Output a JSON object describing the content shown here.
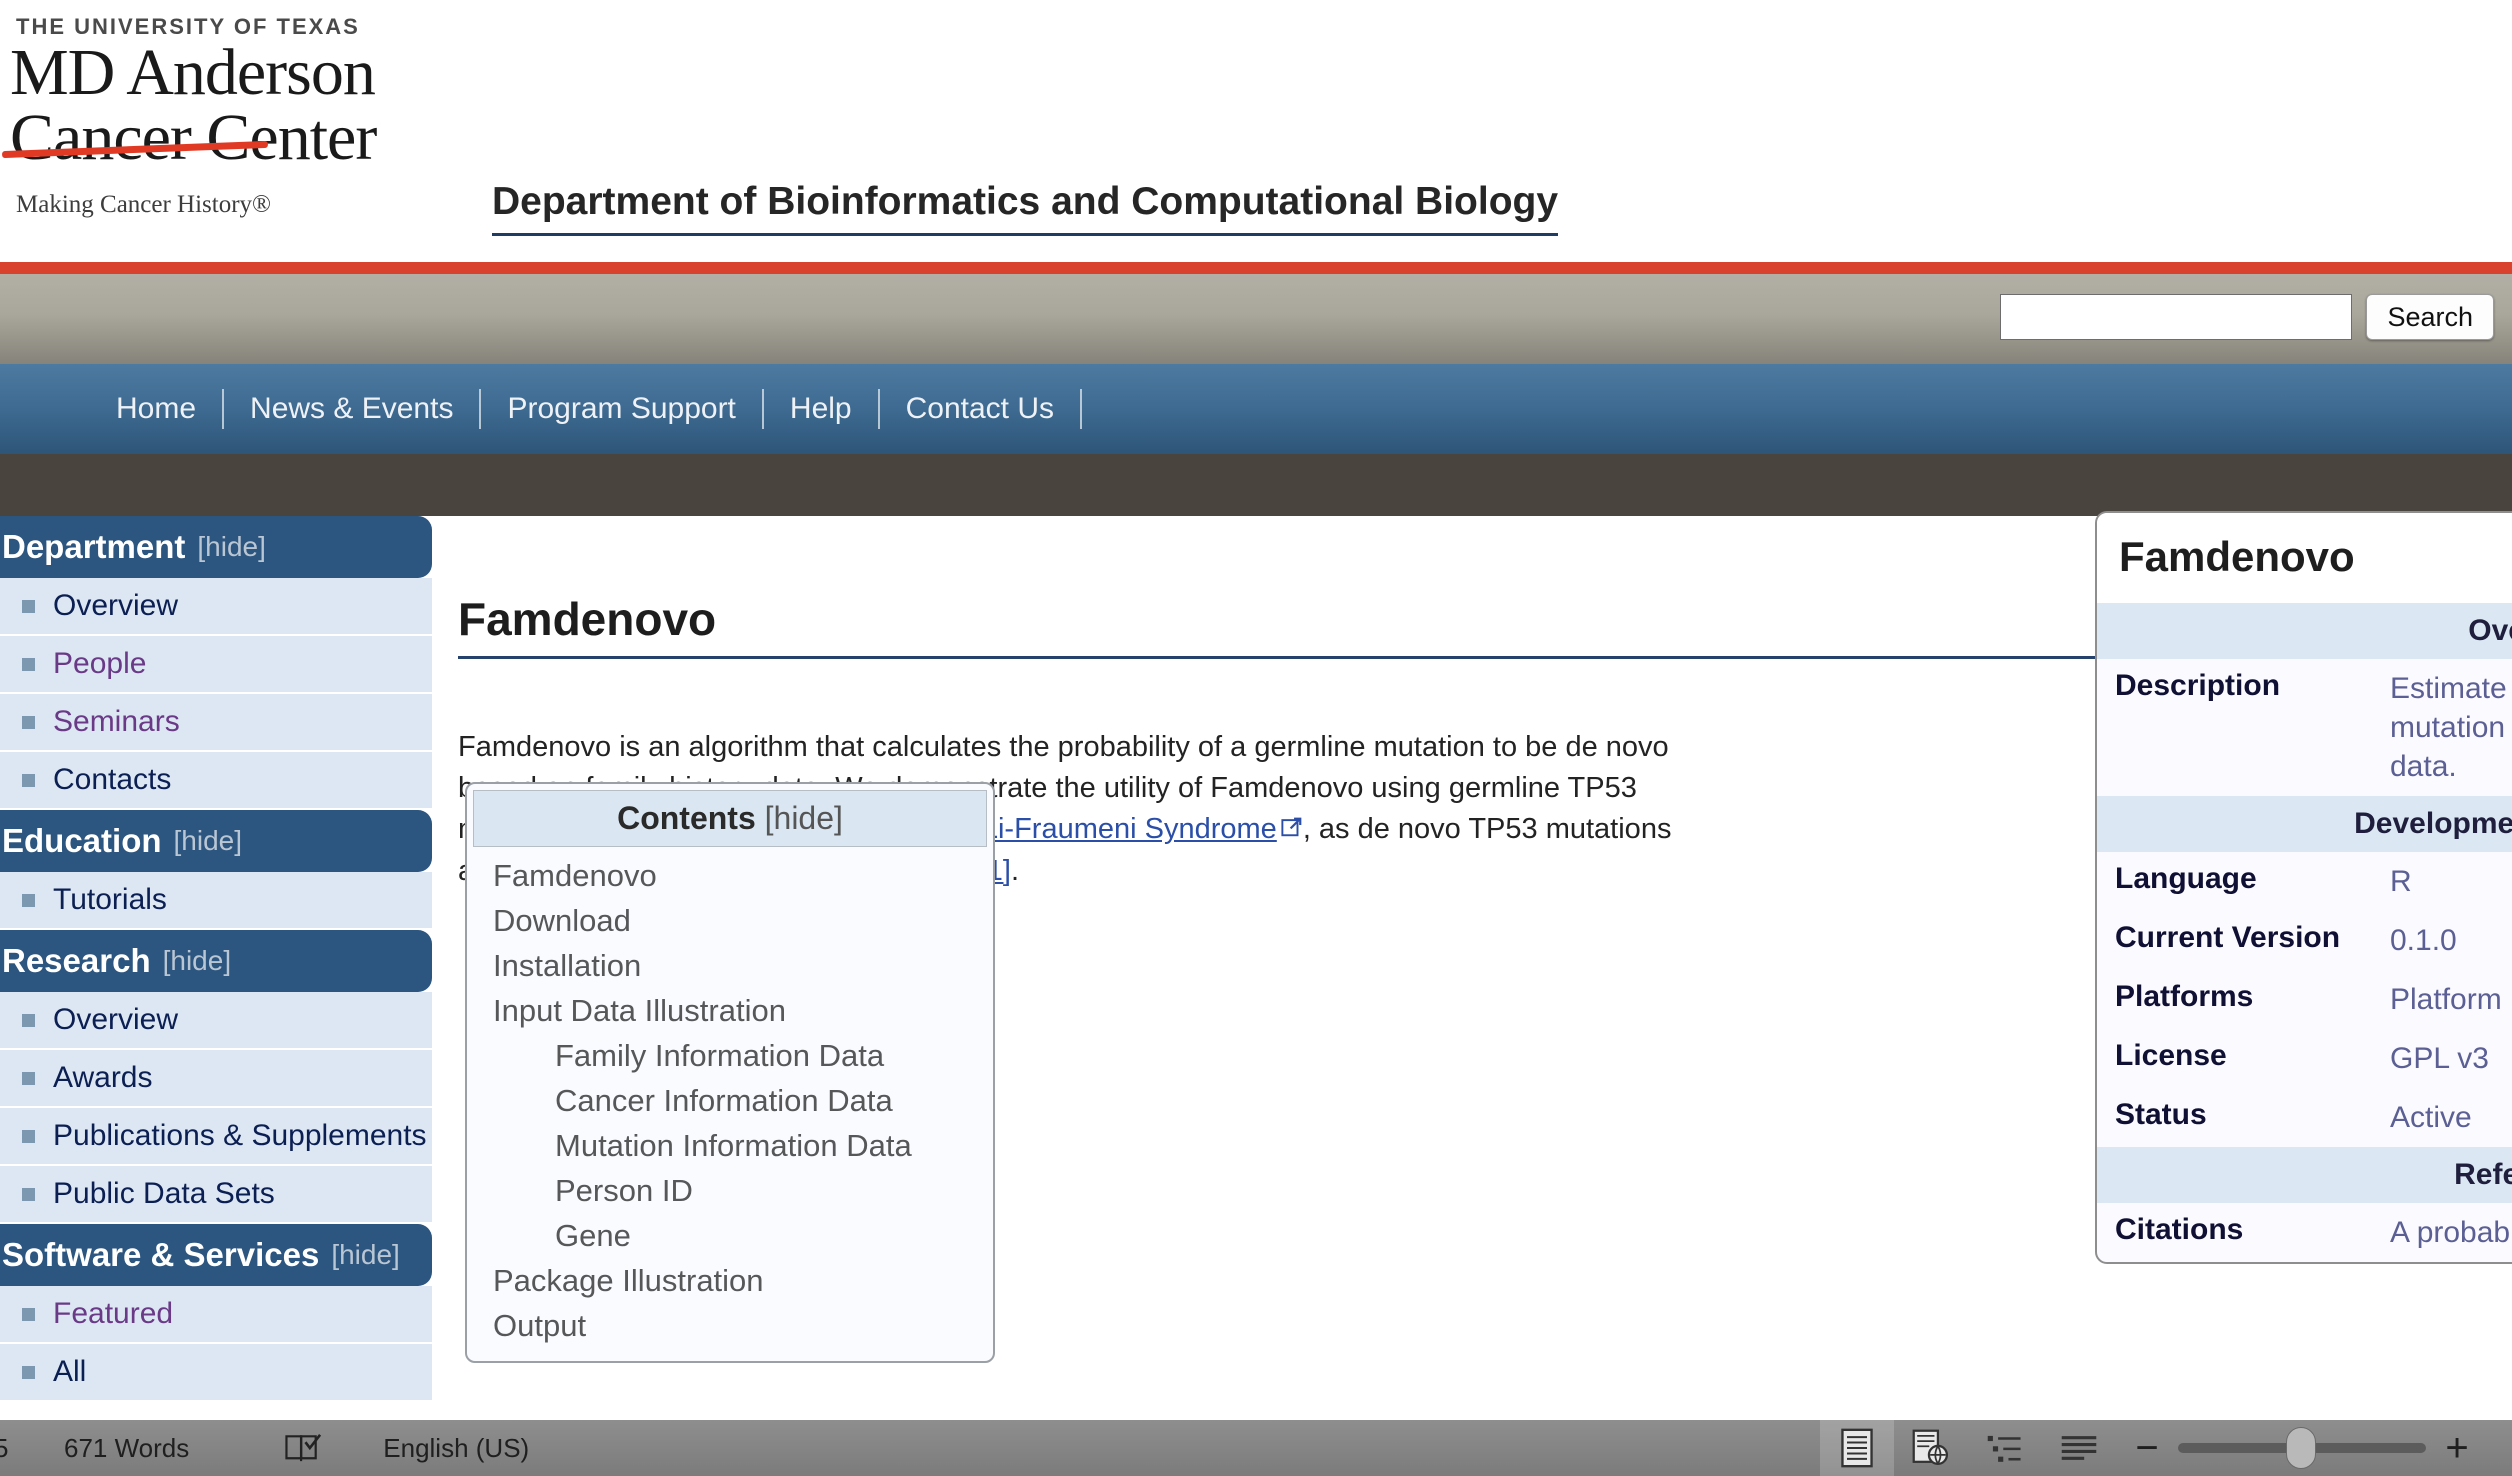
{
  "header": {
    "logo_university": "THE UNIVERSITY OF TEXAS",
    "logo_line1": "MD Anderson",
    "logo_line2": "Cancer Center",
    "logo_tagline": "Making Cancer History®",
    "department_title": "Department of Bioinformatics and Computational Biology"
  },
  "search": {
    "value": "",
    "placeholder": "",
    "button_label": "Search"
  },
  "nav": {
    "items": [
      {
        "label": "Home"
      },
      {
        "label": "News & Events"
      },
      {
        "label": "Program Support"
      },
      {
        "label": "Help"
      },
      {
        "label": "Contact Us"
      }
    ]
  },
  "sidebar": {
    "hide_label": "[hide]",
    "groups": [
      {
        "title": "Department",
        "items": [
          {
            "label": "Overview",
            "visited": false
          },
          {
            "label": "People",
            "visited": true
          },
          {
            "label": "Seminars",
            "visited": true
          },
          {
            "label": "Contacts",
            "visited": false
          }
        ]
      },
      {
        "title": "Education",
        "items": [
          {
            "label": "Tutorials",
            "visited": false
          }
        ]
      },
      {
        "title": "Research",
        "items": [
          {
            "label": "Overview",
            "visited": false
          },
          {
            "label": "Awards",
            "visited": false
          },
          {
            "label": "Publications & Supplements",
            "visited": false
          },
          {
            "label": "Public Data Sets",
            "visited": false
          }
        ]
      },
      {
        "title": "Software & Services",
        "items": [
          {
            "label": "Featured",
            "visited": true
          },
          {
            "label": "All",
            "visited": false
          }
        ]
      }
    ]
  },
  "main": {
    "page_title": "Famdenovo",
    "intro": {
      "part1": "Famdenovo is an algorithm that calculates the probability of a germline mutation to be de novo based on family history data. We demonstrate the utility of Famdenovo using germline TP53 mutations, which is a main cause for the ",
      "link_text": "Li-Fraumeni Syndrome",
      "part2": ", as de novo TP53 mutations account for 7%-20% of the LFS patients.",
      "citation": "[1]",
      "part3": "."
    }
  },
  "toc": {
    "title": "Contents",
    "hide_label": "[hide]",
    "entries": [
      {
        "label": "Famdenovo",
        "level": 1
      },
      {
        "label": "Download",
        "level": 1
      },
      {
        "label": "Installation",
        "level": 1
      },
      {
        "label": "Input Data Illustration",
        "level": 1
      },
      {
        "label": "Family Information Data",
        "level": 2
      },
      {
        "label": "Cancer Information Data",
        "level": 2
      },
      {
        "label": "Mutation Information Data",
        "level": 2
      },
      {
        "label": "Person ID",
        "level": 2
      },
      {
        "label": "Gene",
        "level": 2
      },
      {
        "label": "Package Illustration",
        "level": 1
      },
      {
        "label": "Output",
        "level": 1
      }
    ]
  },
  "infobox": {
    "title": "Famdenovo",
    "sections": [
      {
        "heading": "Overview",
        "rows": [
          {
            "key": "Description",
            "value": "Estimate the probability of a germline mutation to be de novo using family history data."
          }
        ]
      },
      {
        "heading": "Development Information",
        "rows": [
          {
            "key": "Language",
            "value": "R"
          },
          {
            "key": "Current Version",
            "value": "0.1.0"
          },
          {
            "key": "Platforms",
            "value": "Platform independent"
          },
          {
            "key": "License",
            "value": "GPL v3"
          },
          {
            "key": "Status",
            "value": "Active"
          }
        ]
      },
      {
        "heading": "References",
        "rows": [
          {
            "key": "Citations",
            "value": "A probabilistic algorithm to predict"
          }
        ]
      }
    ]
  },
  "statusbar": {
    "page_number": "5",
    "word_count": "671 Words",
    "proofing_icon": "proofing-book-icon",
    "language": "English (US)",
    "zoom_minus": "−",
    "zoom_plus": "+"
  },
  "colors": {
    "accent_red": "#d9422c",
    "nav_blue": "#3f6b92",
    "sidebar_head": "#2c557f",
    "sidebar_item": "#dce7f3",
    "link": "#2b4fa8",
    "visited_link": "#6a3a86"
  }
}
